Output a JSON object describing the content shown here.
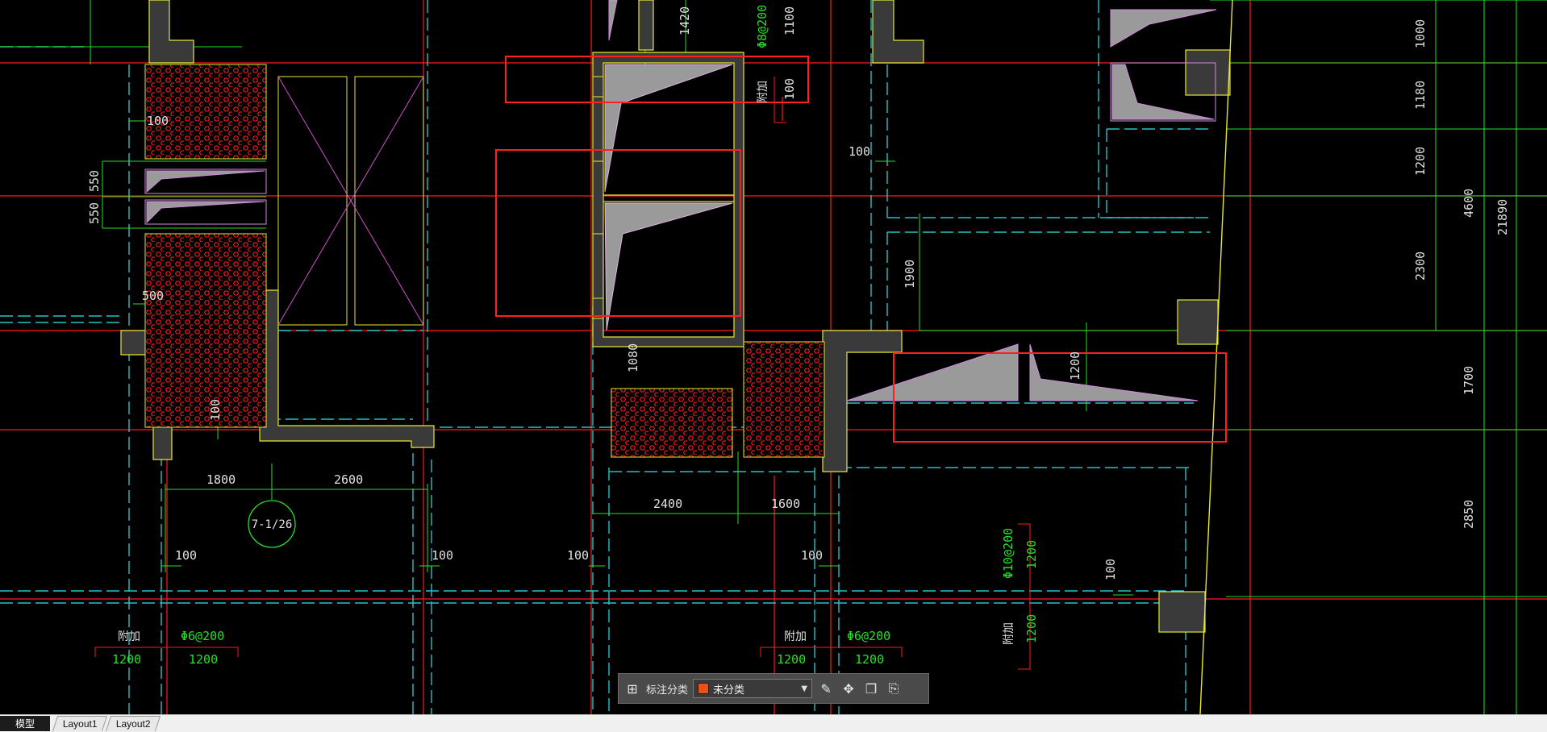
{
  "drawing": {
    "dims": {
      "d100a": "100",
      "d550a": "550",
      "d550b": "550",
      "d500": "500",
      "d100b": "100",
      "d1800": "1800",
      "d2600": "2600",
      "d100c": "100",
      "d100d": "100",
      "d100e": "100",
      "d2400": "2400",
      "d1600": "1600",
      "d100f": "100",
      "d1080": "1080",
      "d1420": "1420",
      "d1100": "1100",
      "d100g": "100",
      "d100h": "100",
      "d1900": "1900",
      "d1200": "1200",
      "d100i": "100",
      "r1000": "1000",
      "r1180": "1180",
      "r1200": "1200",
      "r2300": "2300",
      "r4600": "4600",
      "r21890": "21890",
      "r1700": "1700",
      "r2850": "2850"
    },
    "rebar": {
      "l1": "Φ6@200",
      "l1a": "1200",
      "l1b": "1200",
      "l2": "Φ6@200",
      "l2a": "1200",
      "l2b": "1200",
      "l3": "Φ10@200",
      "l3a": "1200",
      "l3b": "1200",
      "top": "Φ8@200"
    },
    "notes": {
      "fujia1": "附加",
      "fujia2": "附加",
      "fujia3": "附加",
      "fujia4": "附加"
    },
    "grid_tag": "7-1/26"
  },
  "toolbar": {
    "grid_icon": "grid-icon",
    "label": "标注分类",
    "selected": "未分类",
    "swatch_color": "#e8501c",
    "tools": [
      "edit-icon",
      "move-icon",
      "copy-icon",
      "paste-icon"
    ]
  },
  "tabs": [
    {
      "label": "模型",
      "active": true
    },
    {
      "label": "Layout1",
      "active": false
    },
    {
      "label": "Layout2",
      "active": false
    }
  ],
  "colors": {
    "red": "#ff1a1a",
    "green": "#27e027",
    "cyan": "#23c4c8",
    "yellow": "#e8e832",
    "wall": "#3a3a3a"
  }
}
